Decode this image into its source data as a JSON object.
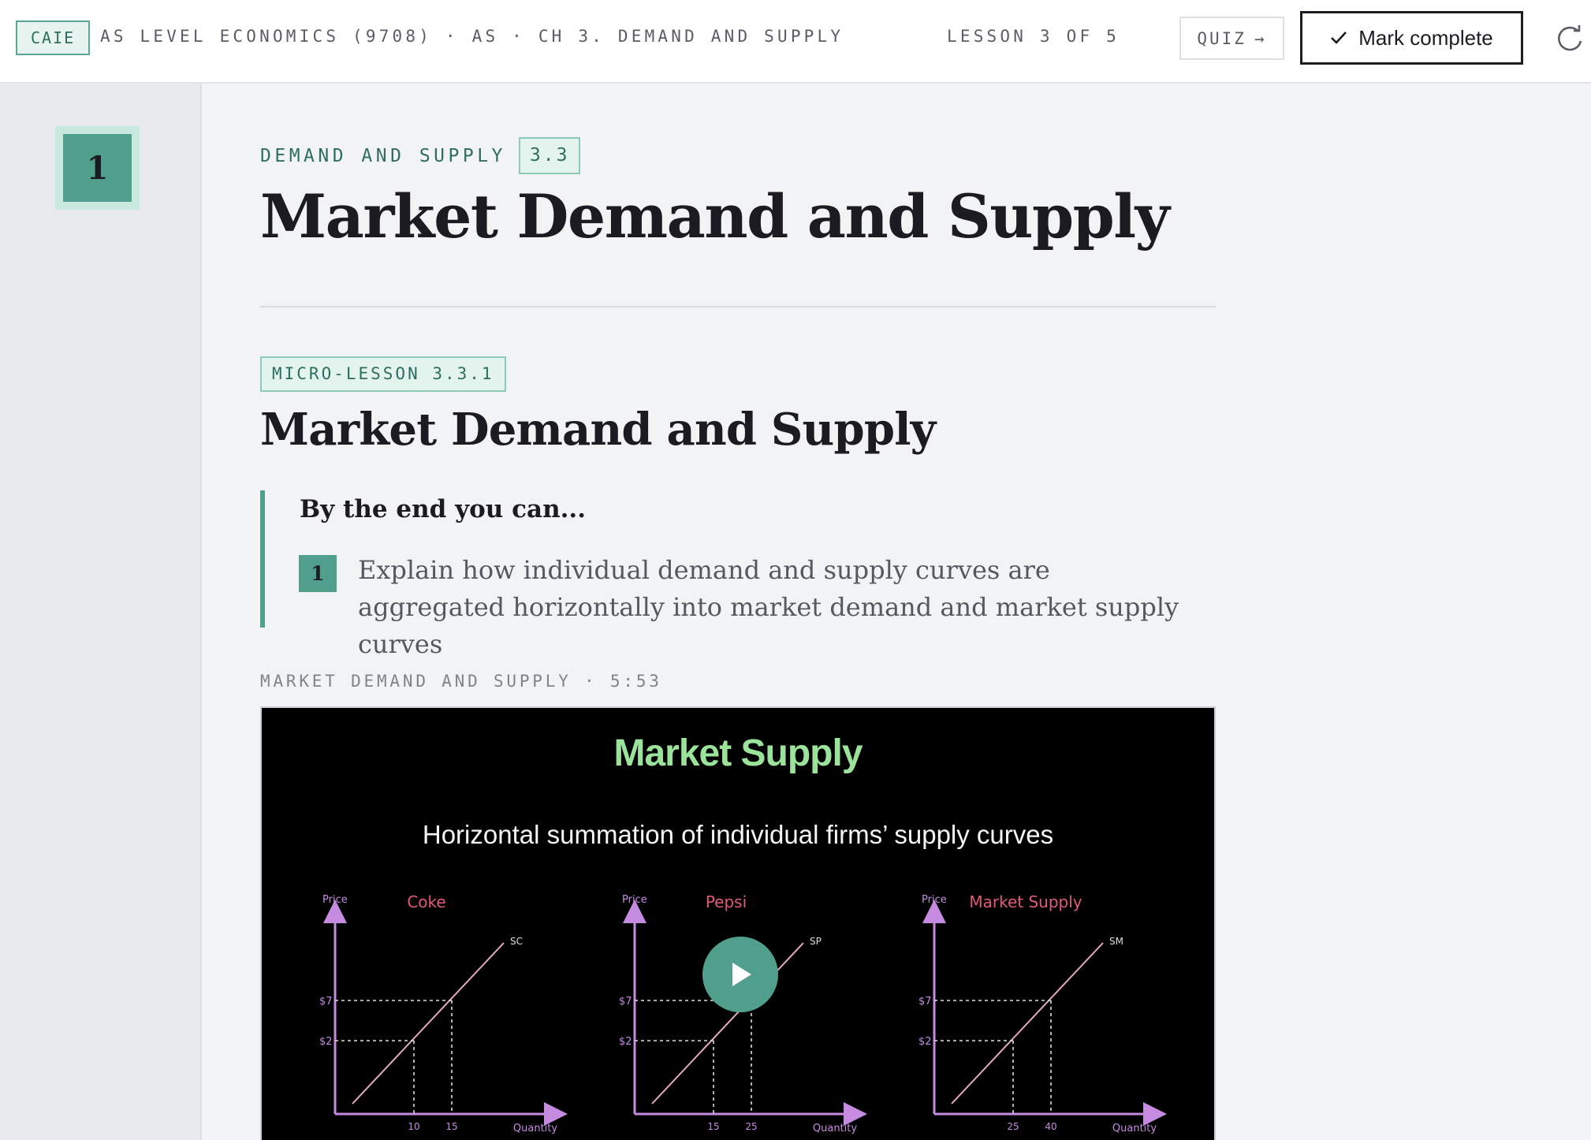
{
  "header": {
    "board": "CAIE",
    "breadcrumb": "AS LEVEL ECONOMICS (9708) · AS · CH 3. DEMAND AND SUPPLY",
    "lesson_count": "LESSON 3 OF 5",
    "quiz_label": "QUIZ",
    "mark_complete_label": "Mark complete"
  },
  "rail": {
    "lesson_number": "1"
  },
  "section": {
    "eyebrow": "DEMAND AND SUPPLY",
    "number": "3.3",
    "title": "Market Demand and Supply"
  },
  "micro_lesson": {
    "tag": "MICRO-LESSON 3.3.1",
    "title": "Market Demand and Supply",
    "objectives_heading": "By the end you can...",
    "objectives": [
      {
        "num": "1",
        "text": "Explain how individual demand and supply curves are aggregated horizontally into market demand and market supply curves"
      }
    ]
  },
  "video": {
    "caption": "MARKET DEMAND AND SUPPLY · 5:53",
    "slide_title": "Market Supply",
    "slide_subtitle": "Horizontal summation of individual firms’ supply curves",
    "graphs": [
      {
        "title": "Coke",
        "curve": "SC",
        "y_axis": "Price",
        "x_axis": "Quantity",
        "prices": [
          "$7",
          "$2"
        ],
        "quantities": [
          "10",
          "15"
        ]
      },
      {
        "title": "Pepsi",
        "curve": "SP",
        "y_axis": "Price",
        "x_axis": "Quantity",
        "prices": [
          "$7",
          "$2"
        ],
        "quantities": [
          "15",
          "25"
        ]
      },
      {
        "title": "Market Supply",
        "curve": "SM",
        "y_axis": "Price",
        "x_axis": "Quantity",
        "prices": [
          "$7",
          "$2"
        ],
        "quantities": [
          "25",
          "40"
        ]
      }
    ]
  },
  "colors": {
    "accent": "#4f9f8c",
    "slide_title": "#9be39a",
    "graph_axis": "#c48be0",
    "graph_title": "#e05a78"
  }
}
